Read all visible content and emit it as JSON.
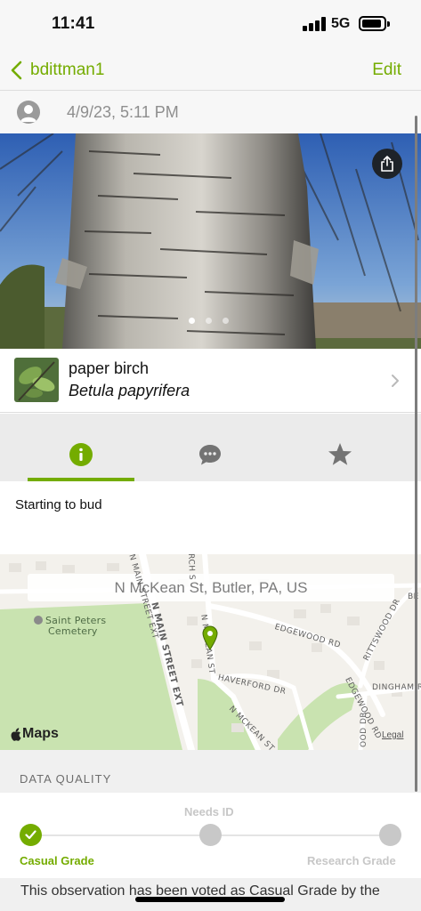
{
  "status_bar": {
    "time": "11:41",
    "network": "5G"
  },
  "nav": {
    "back_label": "bdittman1",
    "edit_label": "Edit"
  },
  "observation": {
    "date": "4/9/23, 5:11 PM"
  },
  "photo": {
    "page_count": 3,
    "current_page": 1
  },
  "taxon": {
    "common_name": "paper birch",
    "scientific_name": "Betula papyrifera"
  },
  "tabs": [
    {
      "icon": "info-icon",
      "selected": true
    },
    {
      "icon": "chat-bubble-icon",
      "selected": false
    },
    {
      "icon": "star-icon",
      "selected": false
    }
  ],
  "description": "Starting to bud",
  "map": {
    "location": "N McKean St, Butler, PA, US",
    "brand": "Maps",
    "legal": "Legal",
    "street_labels": {
      "main_upper": "N MAIN STREET EXT",
      "main": "N MAIN STREET EXT",
      "mckean_upper": "N MCKEAN ST",
      "mckean": "N MCKEAN ST",
      "edgewood": "EDGEWOOD RD",
      "edgewood_lower": "EDGEWOOD RD",
      "rittswood": "RITTSWOOD DR",
      "haverford": "HAVERFORD DR",
      "dingham": "DINGHAM RD",
      "right_upper": "BE",
      "right_lower": "OOD DR",
      "church": "RCH S"
    },
    "poi": {
      "line1": "Saint Peters",
      "line2": "Cemetery"
    }
  },
  "data_quality": {
    "title": "DATA QUALITY",
    "steps": [
      {
        "label": "Casual Grade",
        "active": true
      },
      {
        "label": "Needs ID",
        "active": false
      },
      {
        "label": "Research Grade",
        "active": false
      }
    ],
    "note": "This observation has been voted as Casual Grade by the"
  },
  "colors": {
    "accent": "#74ac00",
    "map_park": "#c9e3b0",
    "map_road": "#ffffff"
  }
}
